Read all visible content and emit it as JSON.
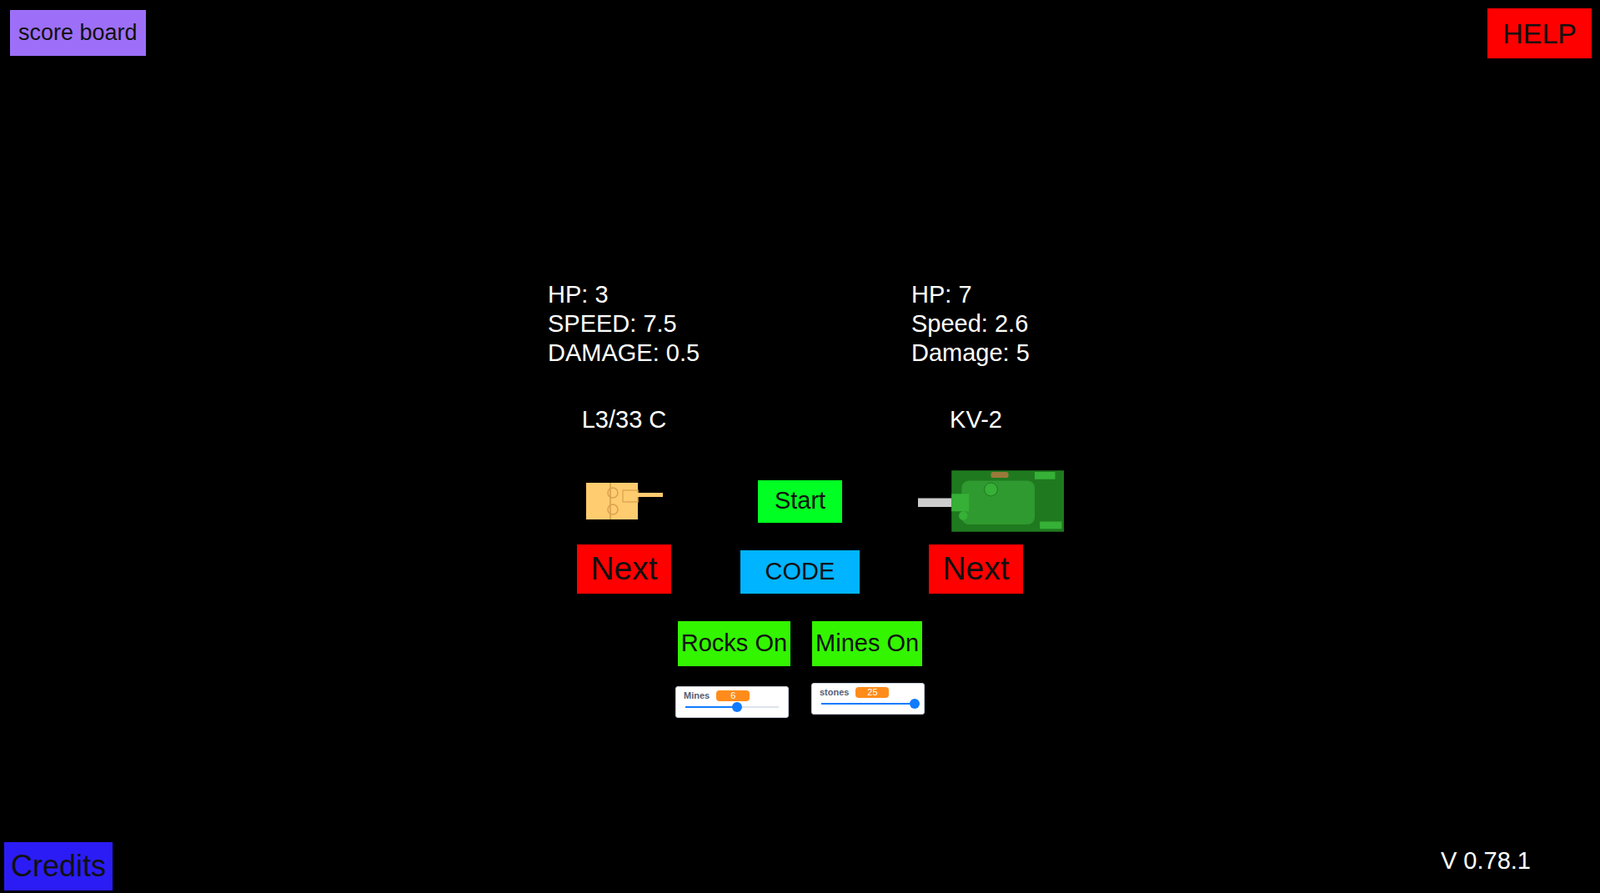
{
  "buttons": {
    "scoreboard": "score board",
    "help": "HELP",
    "credits": "Credits",
    "start": "Start",
    "code": "CODE"
  },
  "version": "V 0.78.1",
  "tanks": [
    {
      "name": "L3/33 C",
      "kind": "light",
      "stats": [
        "HP: 3",
        "SPEED: 7.5",
        "DAMAGE: 0.5"
      ],
      "next": "Next"
    },
    {
      "name": "KV-2",
      "kind": "heavy",
      "stats": [
        "HP: 7",
        "Speed: 2.6",
        "Damage: 5"
      ],
      "next": "Next"
    }
  ],
  "toggles": [
    {
      "label": "Rocks On",
      "on": true
    },
    {
      "label": "Mines On",
      "on": true
    }
  ],
  "sliders": [
    {
      "label": "Mines",
      "value": "6",
      "level": 0.55
    },
    {
      "label": "stones",
      "value": "25",
      "level": 1.0
    }
  ]
}
